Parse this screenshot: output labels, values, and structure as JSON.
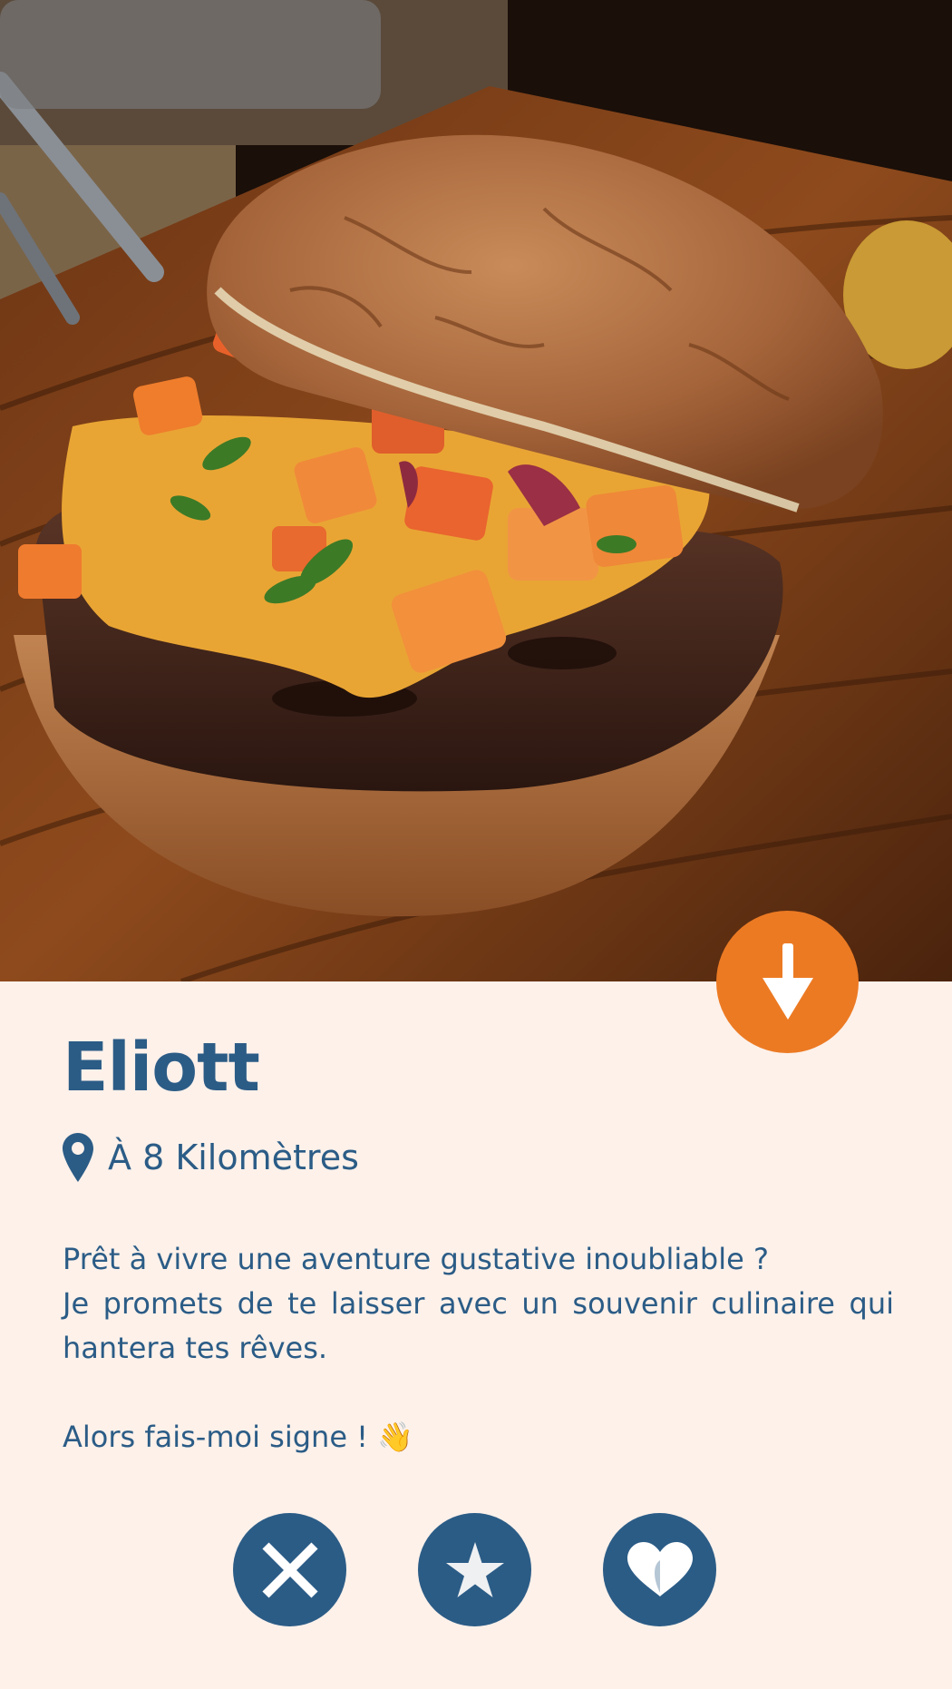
{
  "profile": {
    "name": "Eliott",
    "distance": "À 8 Kilomètres",
    "bio_line_1": "Prêt à vivre une aventure gustative inoubliable ?",
    "bio_line_2": "Je promets de te laisser avec un souvenir culinaire qui hantera tes rêves.",
    "bio_line_3": "Alors fais-moi signe ! 👋"
  },
  "icons": {
    "scroll_down": "arrow-down-icon",
    "location": "map-pin-icon",
    "dislike": "close-icon",
    "superlike": "star-icon",
    "like": "heart-icon"
  },
  "colors": {
    "background": "#fdf1ea",
    "primary": "#2b5c86",
    "accent": "#ec7a23"
  }
}
